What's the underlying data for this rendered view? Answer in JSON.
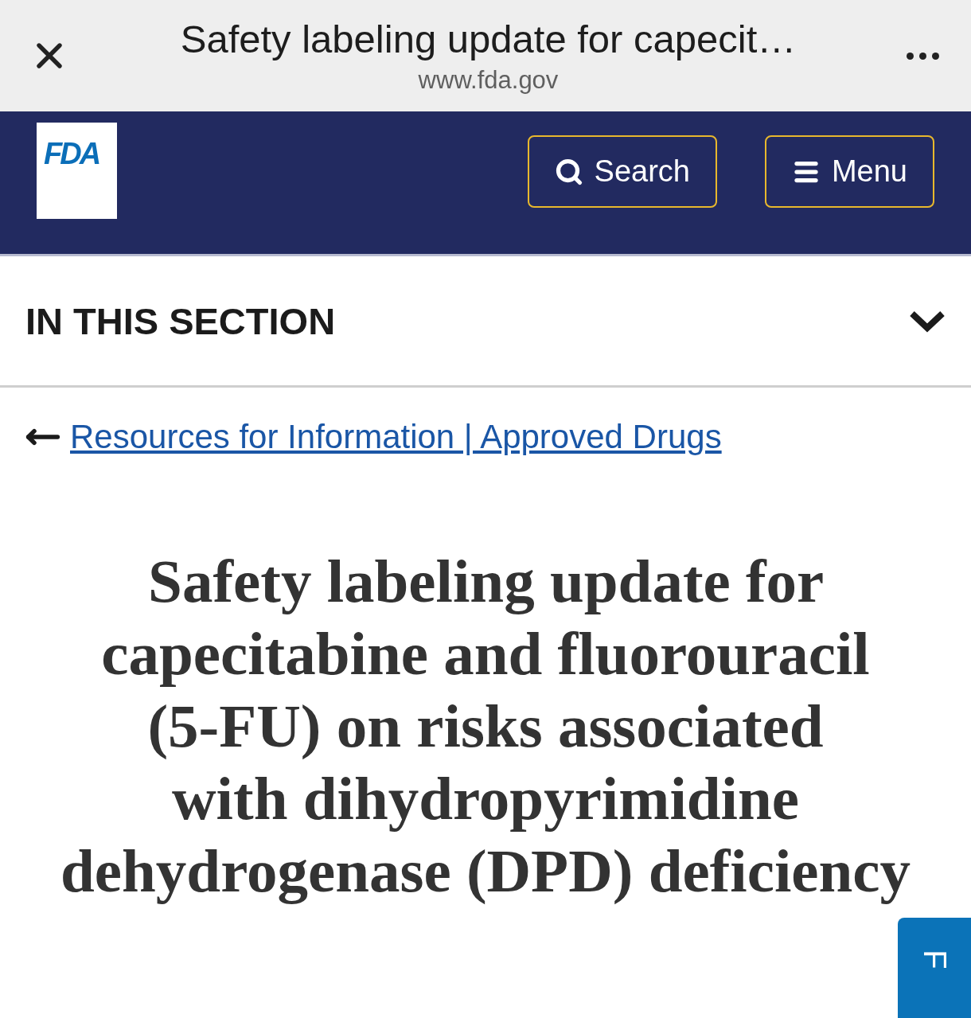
{
  "browser_bar": {
    "title": "Safety labeling update for capecit…",
    "url": "www.fda.gov"
  },
  "header": {
    "logo": "FDA",
    "buttons": [
      {
        "kind": "search",
        "label": "Search"
      },
      {
        "kind": "menu",
        "label": "Menu"
      }
    ]
  },
  "section_nav": {
    "label": "IN THIS SECTION",
    "expanded": false
  },
  "breadcrumb": {
    "link": "Resources for Information | Approved Drugs"
  },
  "page_title": "Safety labeling update for capecitabine and fluorouracil (5-FU) on risks associated with dihydropyrimidine dehydrogenase (DPD) deficiency",
  "feedback_tab": {
    "label": "F"
  }
}
